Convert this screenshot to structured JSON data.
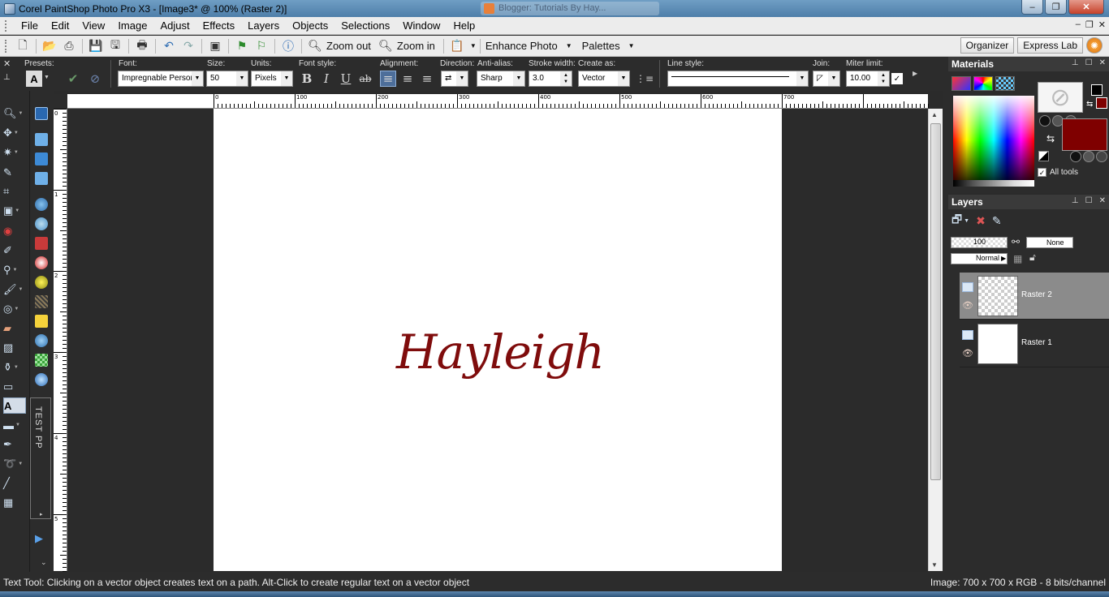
{
  "window": {
    "title": "Corel PaintShop Photo Pro X3 - [Image3* @ 100% (Raster 2)]",
    "background_tab": "Blogger: Tutorials By Hay...",
    "min": "–",
    "max": "❐",
    "close": "✕"
  },
  "menu": [
    "File",
    "Edit",
    "View",
    "Image",
    "Adjust",
    "Effects",
    "Layers",
    "Objects",
    "Selections",
    "Window",
    "Help"
  ],
  "toolbar": {
    "zoom_out": "Zoom out",
    "zoom_in": "Zoom in",
    "enhance_photo": "Enhance Photo",
    "palettes": "Palettes",
    "organizer": "Organizer",
    "express_lab": "Express Lab"
  },
  "options": {
    "presets_label": "Presets:",
    "font_label": "Font:",
    "font_value": "Impregnable Persor",
    "size_label": "Size:",
    "size_value": "50",
    "units_label": "Units:",
    "units_value": "Pixels",
    "fontstyle_label": "Font style:",
    "alignment_label": "Alignment:",
    "direction_label": "Direction:",
    "antialias_label": "Anti-alias:",
    "antialias_value": "Sharp",
    "strokewidth_label": "Stroke width:",
    "strokewidth_value": "3.0",
    "createas_label": "Create as:",
    "createas_value": "Vector",
    "linestyle_label": "Line style:",
    "join_label": "Join:",
    "miter_label": "Miter limit:",
    "miter_value": "10.00"
  },
  "ruler": {
    "h_labels": [
      "0",
      "100",
      "200",
      "300",
      "400",
      "500",
      "600",
      "700"
    ],
    "v_labels": [
      "0",
      "1",
      "2",
      "3",
      "4",
      "5"
    ]
  },
  "canvas": {
    "text": "Hayleigh",
    "text_color": "#7f0c0c"
  },
  "side_tab": "TEST PP",
  "materials": {
    "title": "Materials",
    "fg_color": "#f5f5f5",
    "bg_color": "#7f0000",
    "all_tools": "All tools"
  },
  "layers": {
    "title": "Layers",
    "opacity": "100",
    "mask": "None",
    "blend": "Normal",
    "items": [
      {
        "name": "Raster 2",
        "selected": true
      },
      {
        "name": "Raster 1",
        "selected": false
      }
    ]
  },
  "status": {
    "message": "Text Tool: Clicking on a vector object creates text on a path. Alt-Click to create regular text on a vector object",
    "image_info": "Image:  700 x 700 x RGB - 8 bits/channel"
  },
  "icons": [
    "app-icon",
    "new-icon",
    "open-icon",
    "scan-icon",
    "save-icon",
    "save-as-icon",
    "print-icon",
    "undo-icon",
    "redo-icon",
    "info-icon",
    "zoom-out-icon",
    "zoom-in-icon",
    "bold-icon",
    "italic-icon",
    "underline-icon",
    "strikethrough-icon",
    "eye-icon",
    "no-color-icon"
  ]
}
